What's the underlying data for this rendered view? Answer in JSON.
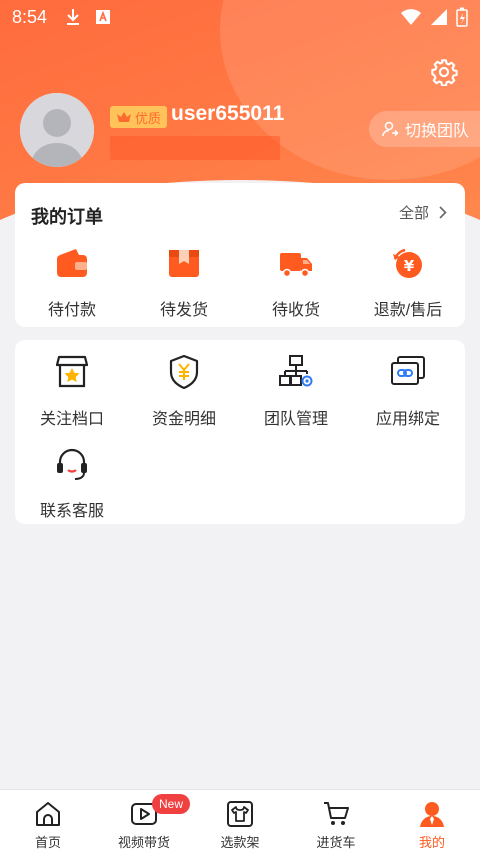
{
  "status_bar": {
    "time": "8:54"
  },
  "profile": {
    "badge_label": "优质",
    "username": "user655011",
    "switch_team_label": "切换团队"
  },
  "orders": {
    "title": "我的订单",
    "all_label": "全部",
    "items": [
      {
        "label": "待付款",
        "icon": "wallet-icon"
      },
      {
        "label": "待发货",
        "icon": "package-icon"
      },
      {
        "label": "待收货",
        "icon": "truck-icon"
      },
      {
        "label": "退款/售后",
        "icon": "refund-icon"
      }
    ]
  },
  "tools": {
    "items": [
      {
        "label": "关注档口",
        "icon": "store-star-icon"
      },
      {
        "label": "资金明细",
        "icon": "shield-yen-icon"
      },
      {
        "label": "团队管理",
        "icon": "org-chart-icon"
      },
      {
        "label": "应用绑定",
        "icon": "link-icon"
      },
      {
        "label": "联系客服",
        "icon": "headset-icon"
      }
    ]
  },
  "tabbar": {
    "new_badge": "New",
    "tabs": [
      {
        "label": "首页",
        "icon": "home-icon"
      },
      {
        "label": "视频带货",
        "icon": "video-icon"
      },
      {
        "label": "选款架",
        "icon": "shirt-icon"
      },
      {
        "label": "进货车",
        "icon": "cart-icon"
      },
      {
        "label": "我的",
        "icon": "user-icon"
      }
    ],
    "active_tab": "我的"
  },
  "colors": {
    "accent": "#ff5a1f",
    "header": "#ff6b3d",
    "background": "#f2f2f4"
  }
}
